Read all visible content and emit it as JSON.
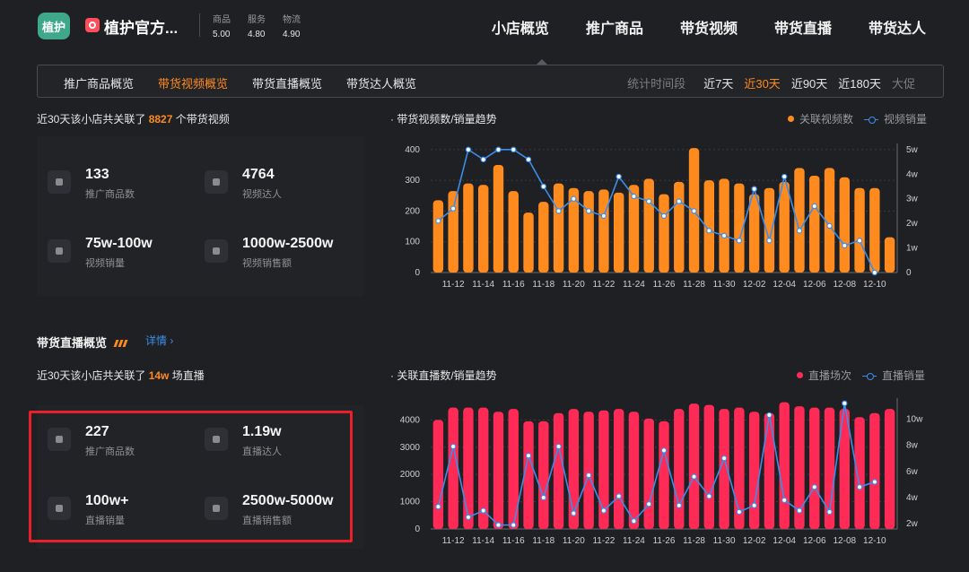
{
  "header": {
    "logo_text": "植护",
    "store_name": "植护官方...",
    "scores": [
      {
        "label": "商品",
        "value": "5.00"
      },
      {
        "label": "服务",
        "value": "4.80"
      },
      {
        "label": "物流",
        "value": "4.90"
      }
    ],
    "nav": [
      "小店概览",
      "推广商品",
      "带货视频",
      "带货直播",
      "带货达人"
    ]
  },
  "subnav": {
    "tabs": [
      "推广商品概览",
      "带货视频概览",
      "带货直播概览",
      "带货达人概览"
    ],
    "active_tab": 1,
    "period_label": "统计时间段",
    "periods": [
      "近7天",
      "近30天",
      "近90天",
      "近180天",
      "大促"
    ],
    "active_period": 1
  },
  "video": {
    "summary_prefix": "近30天该小店共关联了",
    "summary_count": "8827",
    "summary_suffix": "个带货视频",
    "stats": [
      {
        "value": "133",
        "label": "推广商品数"
      },
      {
        "value": "4764",
        "label": "视频达人"
      },
      {
        "value": "75w-100w",
        "label": "视频销量"
      },
      {
        "value": "1000w-2500w",
        "label": "视频销售额"
      }
    ],
    "chart_title": "· 带货视频数/销量趋势",
    "legend_bar": "关联视频数",
    "legend_line": "视频销量"
  },
  "live": {
    "section_title": "带货直播概览",
    "detail_link": "详情 ›",
    "summary_prefix": "近30天该小店共关联了",
    "summary_count": "14w",
    "summary_suffix": "场直播",
    "stats": [
      {
        "value": "227",
        "label": "推广商品数"
      },
      {
        "value": "1.19w",
        "label": "直播达人"
      },
      {
        "value": "100w+",
        "label": "直播销量"
      },
      {
        "value": "2500w-5000w",
        "label": "直播销售额"
      }
    ],
    "chart_title": "· 关联直播数/销量趋势",
    "legend_bar": "直播场次",
    "legend_line": "直播销量"
  },
  "colors": {
    "accent": "#ff8a1e",
    "video_bar": "#ff8a1e",
    "live_bar": "#ff2a55",
    "line": "#3b8eea",
    "highlight_frame": "#e8202a"
  },
  "chart_data": [
    {
      "type": "bar",
      "title": "带货视频数/销量趋势",
      "x": [
        "11-11",
        "11-12",
        "11-13",
        "11-14",
        "11-15",
        "11-16",
        "11-17",
        "11-18",
        "11-19",
        "11-20",
        "11-21",
        "11-22",
        "11-23",
        "11-24",
        "11-25",
        "11-26",
        "11-27",
        "11-28",
        "11-29",
        "11-30",
        "12-01",
        "12-02",
        "12-03",
        "12-04",
        "12-05",
        "12-06",
        "12-07",
        "12-08",
        "12-09",
        "12-10",
        "12-11"
      ],
      "x_tick_labels": [
        "11-12",
        "11-14",
        "11-16",
        "11-18",
        "11-20",
        "11-22",
        "11-24",
        "11-26",
        "11-28",
        "11-30",
        "12-02",
        "12-04",
        "12-06",
        "12-08",
        "12-10"
      ],
      "series": [
        {
          "name": "关联视频数",
          "axis": "left",
          "kind": "bar",
          "values": [
            235,
            265,
            290,
            285,
            350,
            265,
            195,
            230,
            290,
            275,
            265,
            270,
            260,
            285,
            305,
            255,
            295,
            405,
            300,
            305,
            290,
            255,
            275,
            295,
            340,
            315,
            340,
            310,
            275,
            275,
            115
          ]
        },
        {
          "name": "视频销量",
          "axis": "right",
          "kind": "line",
          "values": [
            2.1,
            2.6,
            5.0,
            4.6,
            5.0,
            5.0,
            4.6,
            3.5,
            2.5,
            3.0,
            2.5,
            2.3,
            3.9,
            3.1,
            2.9,
            2.3,
            2.9,
            2.5,
            1.7,
            1.5,
            1.3,
            3.4,
            1.3,
            3.9,
            1.7,
            2.7,
            1.9,
            1.1,
            1.3,
            0.0
          ]
        }
      ],
      "y_left": {
        "ticks": [
          0,
          100,
          200,
          300,
          400
        ],
        "range": [
          0,
          420
        ]
      },
      "y_right": {
        "ticks": [
          "0",
          "1w",
          "2w",
          "3w",
          "4w",
          "5w"
        ],
        "range": [
          0,
          5.25
        ]
      },
      "grid": true,
      "legend": "top-right"
    },
    {
      "type": "bar",
      "title": "关联直播数/销量趋势",
      "x": [
        "11-11",
        "11-12",
        "11-13",
        "11-14",
        "11-15",
        "11-16",
        "11-17",
        "11-18",
        "11-19",
        "11-20",
        "11-21",
        "11-22",
        "11-23",
        "11-24",
        "11-25",
        "11-26",
        "11-27",
        "11-28",
        "11-29",
        "11-30",
        "12-01",
        "12-02",
        "12-03",
        "12-04",
        "12-05",
        "12-06",
        "12-07",
        "12-08",
        "12-09",
        "12-10",
        "12-11"
      ],
      "x_tick_labels": [
        "11-12",
        "11-14",
        "11-16",
        "11-18",
        "11-20",
        "11-22",
        "11-24",
        "11-26",
        "11-28",
        "11-30",
        "12-02",
        "12-04",
        "12-06",
        "12-08",
        "12-10"
      ],
      "series": [
        {
          "name": "直播场次",
          "axis": "left",
          "kind": "bar",
          "values": [
            4000,
            4450,
            4450,
            4450,
            4300,
            4400,
            3950,
            3950,
            4250,
            4400,
            4300,
            4350,
            4400,
            4300,
            4050,
            3950,
            4400,
            4600,
            4550,
            4400,
            4450,
            4300,
            4250,
            4650,
            4500,
            4450,
            4450,
            4400,
            4100,
            4250,
            4400
          ]
        },
        {
          "name": "直播销量",
          "axis": "right",
          "kind": "line",
          "values": [
            3.3,
            7.9,
            2.5,
            3.0,
            1.9,
            1.9,
            7.2,
            4.0,
            7.9,
            2.8,
            5.7,
            3.0,
            4.1,
            2.2,
            3.5,
            7.6,
            3.4,
            5.6,
            4.1,
            7.0,
            2.9,
            3.4,
            10.3,
            3.8,
            3.0,
            4.8,
            2.9,
            11.2,
            4.8,
            5.2
          ]
        }
      ],
      "y_left": {
        "ticks": [
          0,
          1000,
          2000,
          3000,
          4000
        ],
        "range": [
          0,
          4800
        ]
      },
      "y_right": {
        "ticks": [
          "2w",
          "4w",
          "6w",
          "8w",
          "10w"
        ],
        "range": [
          1.6,
          11.6
        ]
      },
      "grid": true,
      "legend": "top-right"
    }
  ]
}
